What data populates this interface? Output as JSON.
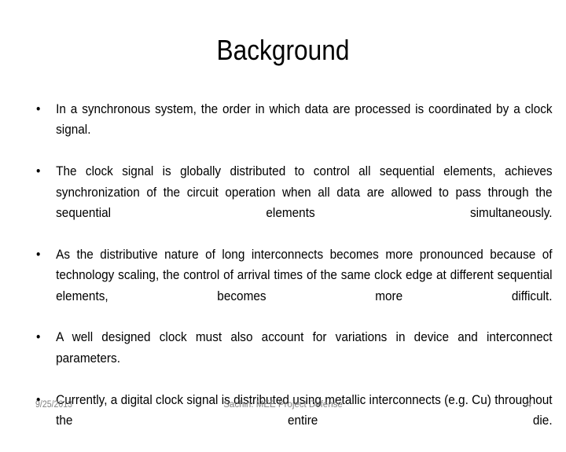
{
  "slide": {
    "title": "Background",
    "background_color": "#ffffff",
    "text_color": "#000000",
    "footer_color": "#808080",
    "bullet_marker": "•",
    "bullets": [
      {
        "text": "In a synchronous system, the order in which data are processed is coordinated by a clock signal."
      },
      {
        "text": "The clock signal is globally distributed to control all sequential elements, achieves synchronization of the circuit operation when all data are allowed to pass through the sequential elements simultaneously."
      },
      {
        "text": "As the distributive nature of long interconnects becomes more pronounced because of technology scaling, the control of arrival times of the same clock edge at different sequential elements, becomes more difficult."
      },
      {
        "text": "A well designed clock must also account for variations in device and interconnect parameters."
      },
      {
        "text": "Currently, a digital clock signal is distributed using metallic interconnects (e.g. Cu) throughout the entire die."
      }
    ],
    "footer": {
      "date": "9/25/2013",
      "center": "Sachin: MEE Project Defense",
      "page_number": "4"
    }
  }
}
